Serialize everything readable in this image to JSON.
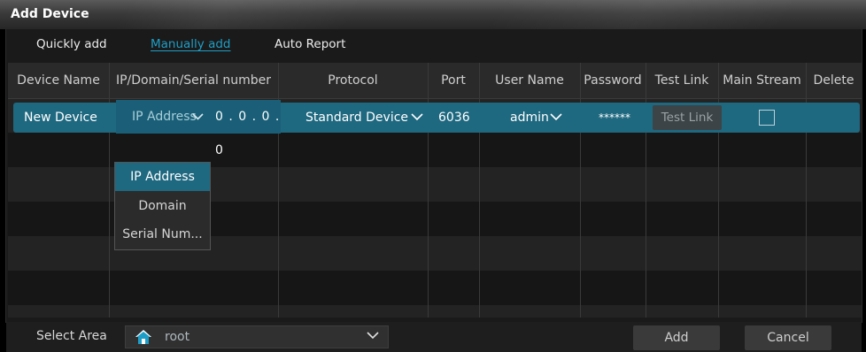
{
  "window": {
    "title": "Add Device"
  },
  "tabs": [
    {
      "label": "Quickly add",
      "active": false
    },
    {
      "label": "Manually add",
      "active": true
    },
    {
      "label": "Auto Report",
      "active": false
    }
  ],
  "table": {
    "columns": [
      "Device Name",
      "IP/Domain/Serial number",
      "Protocol",
      "Port",
      "User Name",
      "Password",
      "Test Link",
      "Main Stream",
      "Delete"
    ],
    "row": {
      "device_name": "New Device",
      "address_type": "IP Address",
      "address_value": "0 . 0 . 0 . 0",
      "protocol": "Standard Device",
      "port": "6036",
      "user_name": "admin",
      "password": "******",
      "test_link_label": "Test Link",
      "main_stream_checked": false
    }
  },
  "address_type_dropdown": {
    "options": [
      "IP Address",
      "Domain",
      "Serial Num..."
    ],
    "selected": "IP Address"
  },
  "footer": {
    "select_area_label": "Select Area",
    "area_value": "root",
    "add_label": "Add",
    "cancel_label": "Cancel"
  },
  "colors": {
    "accent": "#1e9ec6",
    "selection": "#1e6880",
    "background": "#1a1a1a"
  },
  "icons": {
    "chevron": "chevron-down-icon",
    "area": "home-icon"
  }
}
